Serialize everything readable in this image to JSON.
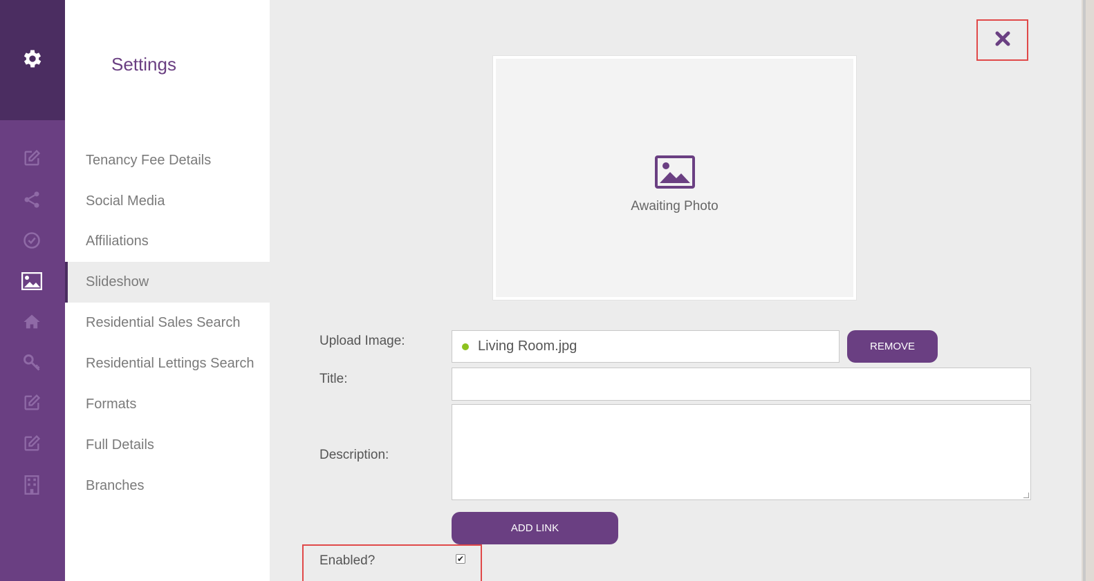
{
  "sidebar": {
    "icons": [
      "settings-gear-icon",
      "edit-icon",
      "share-icon",
      "check-circle-icon",
      "image-icon",
      "home-icon",
      "key-icon",
      "edit-icon",
      "edit-icon",
      "building-icon"
    ]
  },
  "menu": {
    "title": "Settings",
    "items": [
      {
        "label": "Tenancy Fee Details",
        "active": false
      },
      {
        "label": "Social Media",
        "active": false
      },
      {
        "label": "Affiliations",
        "active": false
      },
      {
        "label": "Slideshow",
        "active": true
      },
      {
        "label": "Residential Sales Search",
        "active": false
      },
      {
        "label": "Residential Lettings Search",
        "active": false
      },
      {
        "label": "Formats",
        "active": false
      },
      {
        "label": "Full Details",
        "active": false
      },
      {
        "label": "Branches",
        "active": false
      }
    ]
  },
  "photo": {
    "caption": "Awaiting Photo"
  },
  "form": {
    "upload_label": "Upload Image:",
    "upload_value": "Living Room.jpg",
    "remove_label": "REMOVE",
    "title_label": "Title:",
    "title_value": "",
    "description_label": "Description:",
    "description_value": "",
    "add_link_label": "ADD LINK",
    "enabled_label": "Enabled?",
    "enabled_checked": true
  },
  "colors": {
    "brand": "#6a3f82",
    "brand_dark": "#4b2d61",
    "highlight_border": "#e04848",
    "status_dot": "#8dc21f"
  }
}
